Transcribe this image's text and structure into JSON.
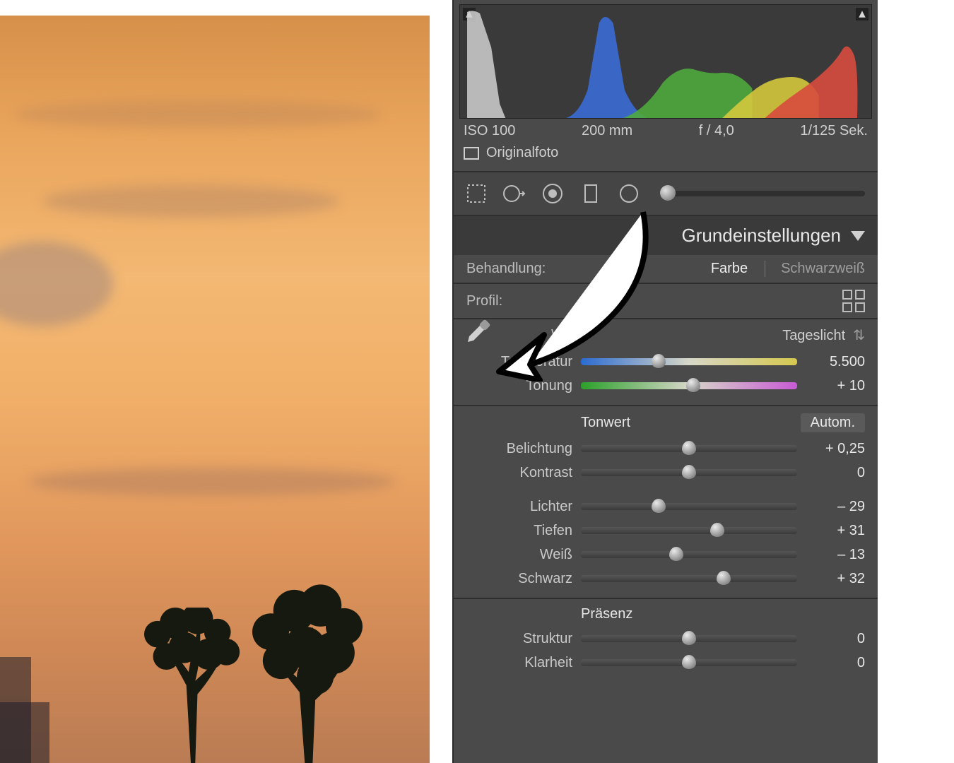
{
  "exif": {
    "iso": "ISO 100",
    "focal": "200 mm",
    "aperture": "f / 4,0",
    "shutter": "1/125 Sek."
  },
  "original_checkbox_label": "Originalfoto",
  "panel_title": "Grundeinstellungen",
  "treatment": {
    "label": "Behandlung:",
    "color": "Farbe",
    "bw": "Schwarzweiß"
  },
  "profile": {
    "label": "Profil:"
  },
  "wb": {
    "label": "WA:",
    "preset": "Tageslicht"
  },
  "temp": {
    "label": "Temperatur",
    "value": "5.500",
    "pos": 36
  },
  "tint": {
    "label": "Tonung",
    "value": "+ 10",
    "pos": 52
  },
  "tone": {
    "title": "Tonwert",
    "auto": "Autom."
  },
  "exposure": {
    "label": "Belichtung",
    "value": "+ 0,25",
    "pos": 50
  },
  "contrast": {
    "label": "Kontrast",
    "value": "0",
    "pos": 50
  },
  "highlights": {
    "label": "Lichter",
    "value": "– 29",
    "pos": 36
  },
  "shadows": {
    "label": "Tiefen",
    "value": "+ 31",
    "pos": 63
  },
  "whites": {
    "label": "Weiß",
    "value": "– 13",
    "pos": 44
  },
  "blacks": {
    "label": "Schwarz",
    "value": "+ 32",
    "pos": 66
  },
  "presence": {
    "title": "Präsenz"
  },
  "texture": {
    "label": "Struktur",
    "value": "0",
    "pos": 50
  },
  "clarity": {
    "label": "Klarheit",
    "value": "0",
    "pos": 50
  }
}
